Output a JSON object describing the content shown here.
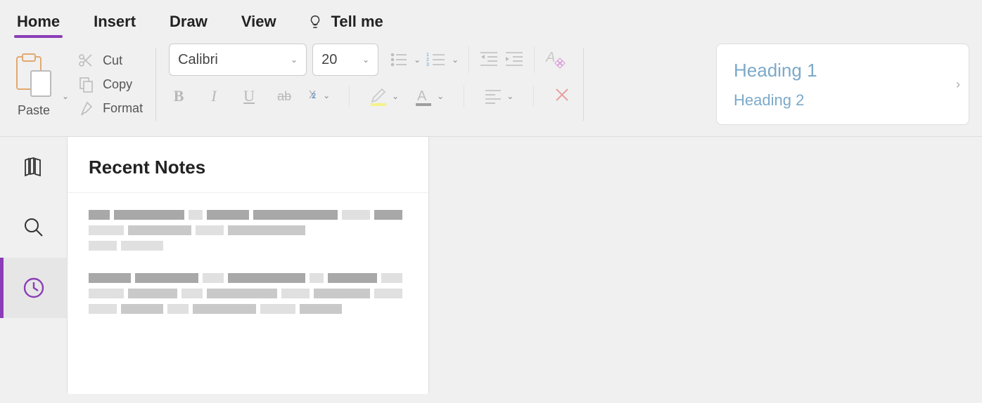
{
  "tabs": {
    "home": "Home",
    "insert": "Insert",
    "draw": "Draw",
    "view": "View",
    "tellme": "Tell me"
  },
  "clipboard": {
    "paste": "Paste",
    "cut": "Cut",
    "copy": "Copy",
    "format": "Format"
  },
  "font": {
    "name": "Calibri",
    "size": "20",
    "sub_marker": "2"
  },
  "styles": {
    "h1": "Heading 1",
    "h2": "Heading 2"
  },
  "panel": {
    "title": "Recent Notes"
  },
  "colors": {
    "accent": "#8b3db7",
    "heading_blue": "#7ca9c9"
  }
}
